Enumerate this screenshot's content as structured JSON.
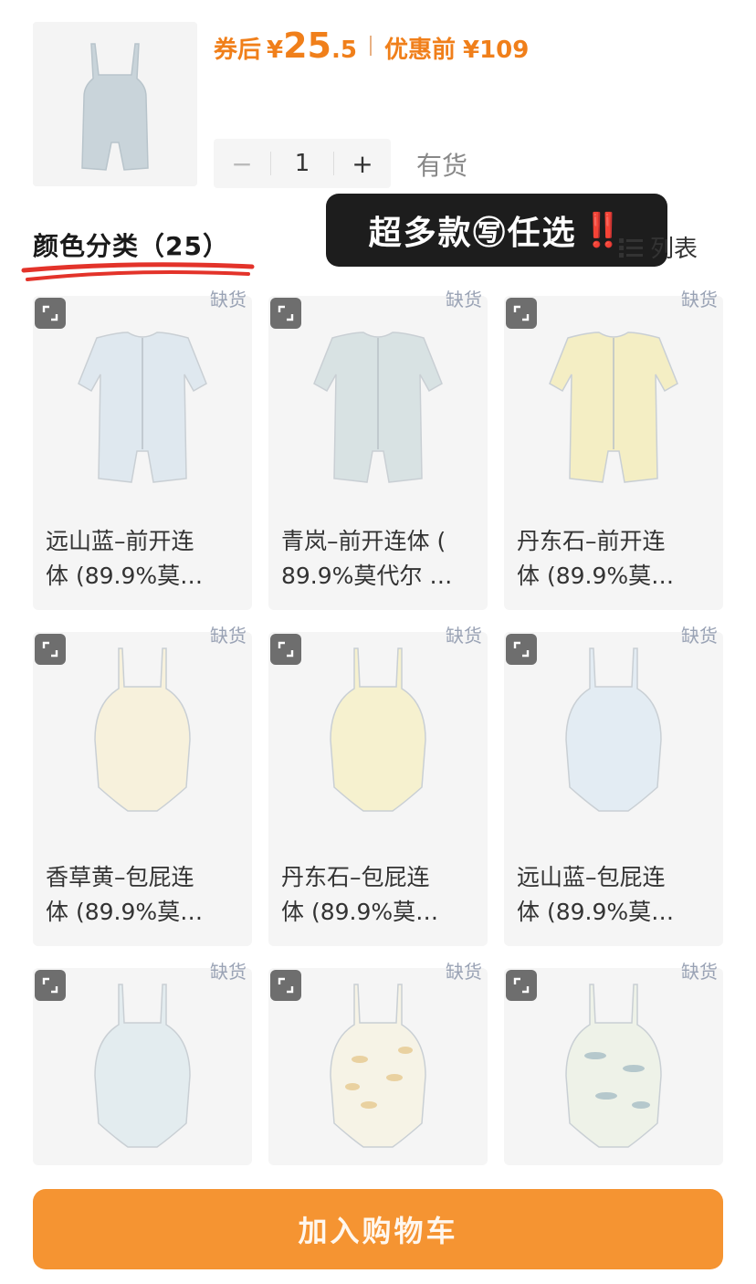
{
  "header": {
    "coupon_label": "券后",
    "currency": "¥",
    "price_int": "25",
    "price_dec": ".5",
    "original_label": "优惠前",
    "original_price": "¥109",
    "quantity": "1",
    "minus": "−",
    "plus": "+",
    "stock_status": "有货"
  },
  "section": {
    "title": "颜色分类（25）",
    "list_label": "列表"
  },
  "promo": {
    "text": "超多款㊢任选",
    "exclaim": "‼️"
  },
  "items": [
    {
      "line1": "远山蓝–前开连",
      "line2": "体 (89.9%莫…",
      "stock": "缺货",
      "color": "#dfe8ef",
      "style": "romper"
    },
    {
      "line1": "青岚–前开连体 (",
      "line2": "89.9%莫代尔 …",
      "stock": "缺货",
      "color": "#d8e2e3",
      "style": "romper"
    },
    {
      "line1": "丹东石–前开连",
      "line2": "体 (89.9%莫…",
      "stock": "缺货",
      "color": "#f4eec4",
      "style": "romper"
    },
    {
      "line1": "香草黄–包屁连",
      "line2": "体 (89.9%莫…",
      "stock": "缺货",
      "color": "#f7f1dc",
      "style": "bodysuit"
    },
    {
      "line1": "丹东石–包屁连",
      "line2": "体 (89.9%莫…",
      "stock": "缺货",
      "color": "#f6f1cf",
      "style": "bodysuit"
    },
    {
      "line1": "远山蓝–包屁连",
      "line2": "体 (89.9%莫…",
      "stock": "缺货",
      "color": "#e3ecf3",
      "style": "bodysuit"
    },
    {
      "line1": "",
      "line2": "",
      "stock": "缺货",
      "color": "#e3ecef",
      "style": "bodysuit"
    },
    {
      "line1": "",
      "line2": "",
      "stock": "缺货",
      "color": "#f6f3e6",
      "style": "bodysuit-print"
    },
    {
      "line1": "",
      "line2": "",
      "stock": "缺货",
      "color": "#eef2e8",
      "style": "bodysuit-print2"
    }
  ],
  "cart_button": "加入购物车",
  "colors": {
    "accent": "#f07f1a",
    "cart_bg": "#f59432",
    "promo_bg": "#1d1d1d",
    "underline": "#e3332a",
    "oos_text": "#9aa3b5"
  }
}
